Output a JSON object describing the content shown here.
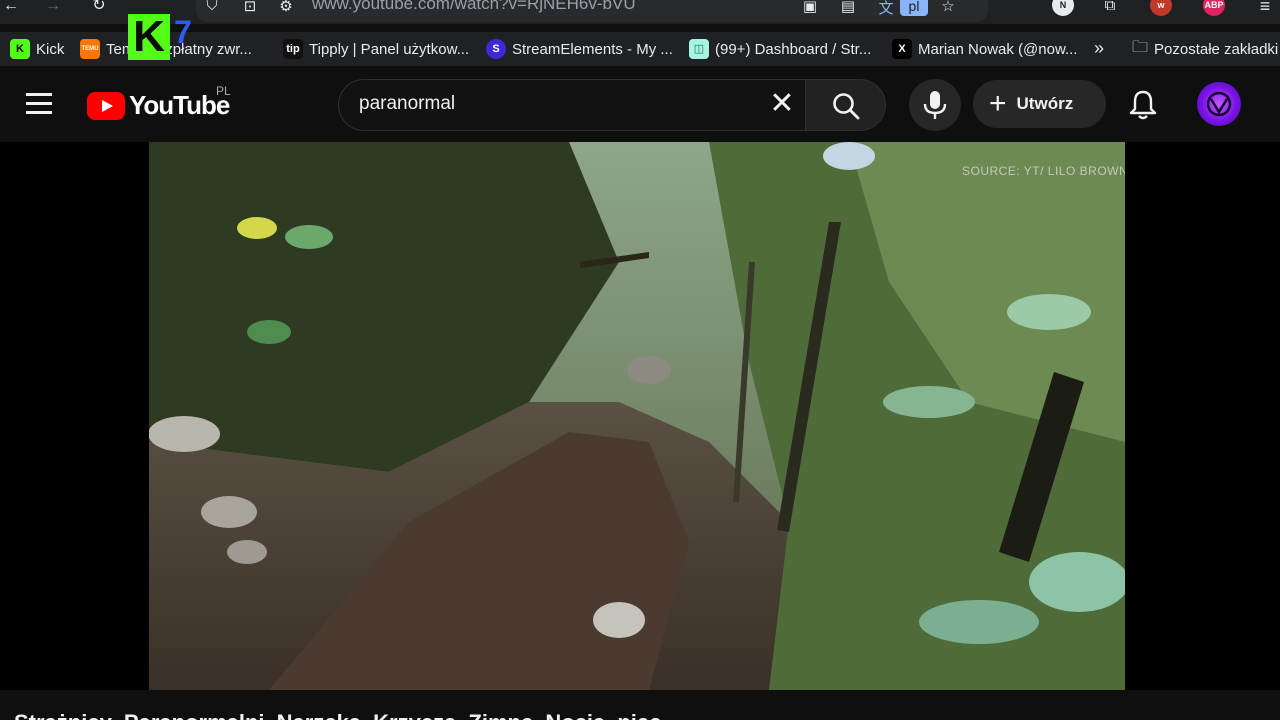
{
  "browser": {
    "url": "www.youtube.com/watch?v=RjNEH6v-bVU",
    "translate_badge": "pl",
    "ext_labels": {
      "n": "N",
      "w": "w",
      "abp": "ABP"
    },
    "bookmarks": [
      {
        "label": "Kick",
        "icon": "kick-icon",
        "fav_text": "K",
        "color": "#53fc18"
      },
      {
        "label": "Temu Bezpłatny zwr...",
        "icon": "temu-icon",
        "fav_text": "TEMU",
        "color": "#fb7701"
      },
      {
        "label": "Tipply | Panel użytkow...",
        "icon": "tipply-icon",
        "fav_text": "tip",
        "color": "#111111"
      },
      {
        "label": "StreamElements - My ...",
        "icon": "streamelements-icon",
        "fav_text": "S",
        "color": "#3c29d9"
      },
      {
        "label": "(99+) Dashboard / Str...",
        "icon": "dashboard-icon",
        "fav_text": "◫",
        "color": "#a6f5e0"
      },
      {
        "label": "Marian Nowak (@now...",
        "icon": "x-icon",
        "fav_text": "X",
        "color": "#000000"
      }
    ],
    "more_bookmarks": "»",
    "other_bookmarks": "Pozostałe zakładki"
  },
  "overlay": {
    "logo": "K",
    "suffix": "7"
  },
  "youtube": {
    "logo_text": "YouTube",
    "country_code": "PL",
    "search_query": "paranormal",
    "create_label": "Utwórz",
    "video_watermark": "SOURCE: YT/ LILO BROWN",
    "video_title": "Strażnicy Paranormalni Narzeka Krzyczą Zimne Nocią niec"
  },
  "colors": {
    "accent_red": "#ff0000",
    "kick_green": "#53fc18",
    "avatar_purple": "#7a12e8"
  }
}
